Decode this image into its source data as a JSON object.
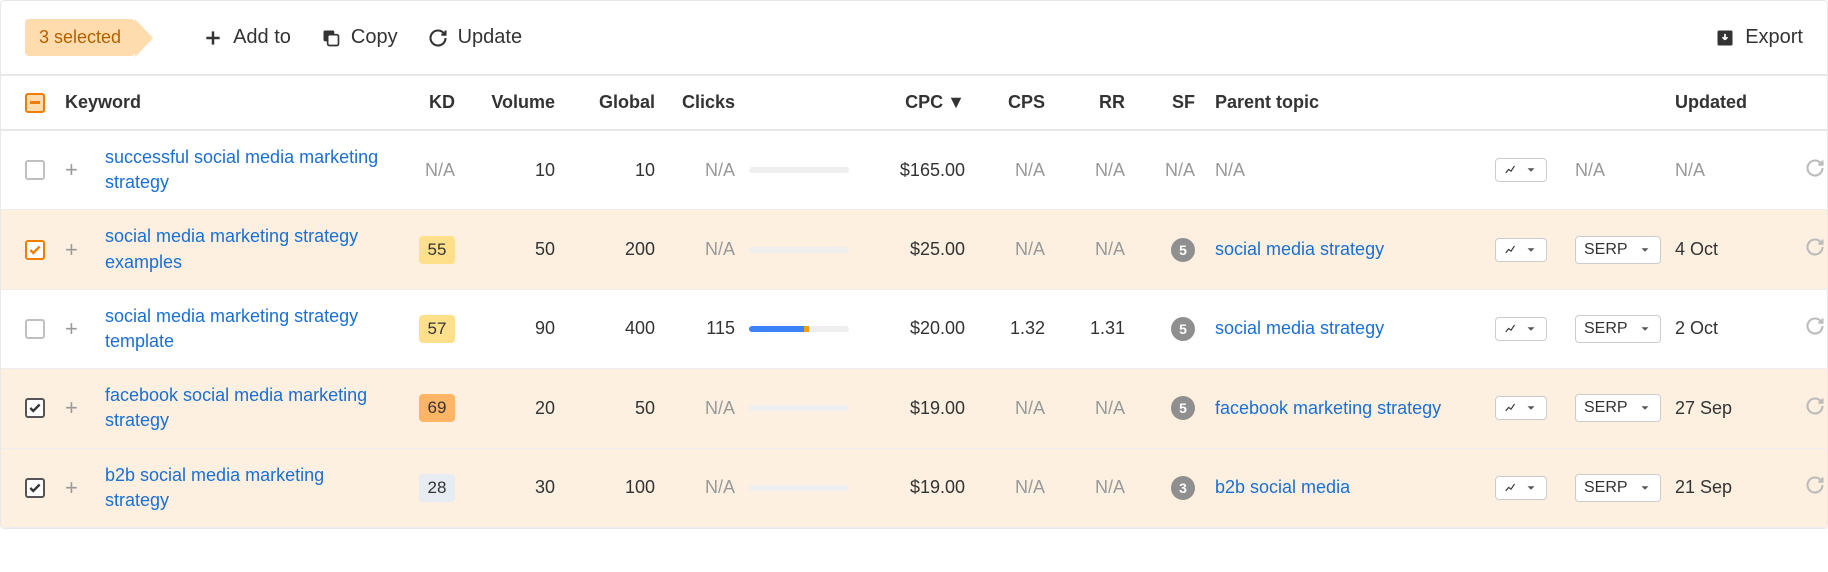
{
  "toolbar": {
    "selected_label": "3 selected",
    "add_to": "Add to",
    "copy": "Copy",
    "update": "Update",
    "export": "Export"
  },
  "columns": {
    "keyword": "Keyword",
    "kd": "KD",
    "volume": "Volume",
    "global": "Global",
    "clicks": "Clicks",
    "cpc": "CPC",
    "cps": "CPS",
    "rr": "RR",
    "sf": "SF",
    "parent": "Parent topic",
    "updated": "Updated"
  },
  "serp_label": "SERP",
  "rows": [
    {
      "selected": false,
      "keyword": "successful social media marketing strategy",
      "kd": null,
      "kd_color": null,
      "volume": "10",
      "global": "10",
      "clicks": "N/A",
      "bar_blue": 0,
      "bar_orange": 0,
      "cpc": "$165.00",
      "cps": "N/A",
      "rr": "N/A",
      "sf": "N/A",
      "sf_badge": false,
      "parent": "N/A",
      "parent_link": false,
      "serp": false,
      "updated": "N/A"
    },
    {
      "selected": true,
      "highlight": true,
      "keyword": "social media marketing strategy examples",
      "kd": "55",
      "kd_color": "#ffe08a",
      "volume": "50",
      "global": "200",
      "clicks": "N/A",
      "bar_blue": 0,
      "bar_orange": 0,
      "cpc": "$25.00",
      "cps": "N/A",
      "rr": "N/A",
      "sf": "5",
      "sf_badge": true,
      "parent": "social media strategy",
      "parent_link": true,
      "serp": true,
      "updated": "4 Oct"
    },
    {
      "selected": false,
      "keyword": "social media marketing strategy template",
      "kd": "57",
      "kd_color": "#ffe08a",
      "volume": "90",
      "global": "400",
      "clicks": "115",
      "bar_blue": 55,
      "bar_orange": 5,
      "cpc": "$20.00",
      "cps": "1.32",
      "rr": "1.31",
      "sf": "5",
      "sf_badge": true,
      "parent": "social media strategy",
      "parent_link": true,
      "serp": true,
      "updated": "2 Oct"
    },
    {
      "selected": true,
      "keyword": "facebook social media marketing strategy",
      "kd": "69",
      "kd_color": "#ffb566",
      "volume": "20",
      "global": "50",
      "clicks": "N/A",
      "bar_blue": 0,
      "bar_orange": 0,
      "cpc": "$19.00",
      "cps": "N/A",
      "rr": "N/A",
      "sf": "5",
      "sf_badge": true,
      "parent": "facebook marketing strategy",
      "parent_link": true,
      "serp": true,
      "updated": "27 Sep"
    },
    {
      "selected": true,
      "keyword": "b2b social media marketing strategy",
      "kd": "28",
      "kd_color": "#e6ecf2",
      "volume": "30",
      "global": "100",
      "clicks": "N/A",
      "bar_blue": 0,
      "bar_orange": 0,
      "cpc": "$19.00",
      "cps": "N/A",
      "rr": "N/A",
      "sf": "3",
      "sf_badge": true,
      "parent": "b2b social media",
      "parent_link": true,
      "serp": true,
      "updated": "21 Sep"
    }
  ]
}
